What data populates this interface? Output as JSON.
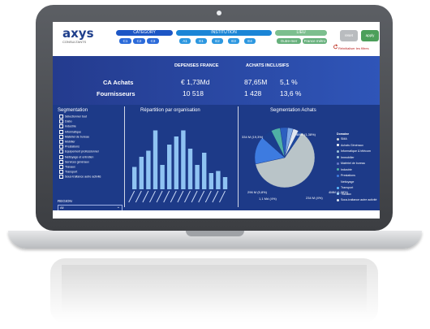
{
  "header": {
    "logo_text": "axys",
    "logo_sub": "CONSULTANTS",
    "filters": [
      {
        "title": "CATEGORY",
        "chips": [
          "C1",
          "C2",
          "C3"
        ]
      },
      {
        "title": "INSTITUTION",
        "chips": [
          "A1",
          "E1",
          "E2",
          "E3",
          "E4"
        ]
      },
      {
        "title": "LIEU",
        "chips": [
          "Outre-mer",
          "France métro"
        ]
      }
    ],
    "btn_reset": "reset",
    "btn_apply": "apply",
    "reset_text": "Réinitialiser les filtres"
  },
  "kpi": {
    "col_headers": [
      "DEPENSES FRANCE",
      "ACHATS INCLUSIFS"
    ],
    "rows": [
      {
        "label": "CA Achats",
        "value1": "€ 1,73Md",
        "value2": "87,65M",
        "pct": "5,1 %"
      },
      {
        "label": "Fournisseurs",
        "value1": "10 518",
        "value2": "1 428",
        "pct": "13,6 %"
      }
    ]
  },
  "segmentation": {
    "title": "Segmentation",
    "items": [
      "Sélectionner tout",
      "Dabo",
      "Industrie",
      "Informatique",
      "Matériel de bureau",
      "Mobilier",
      "Prestations",
      "Equipement professionnel",
      "Nettoyage et entretien",
      "Services généraux",
      "Travaux",
      "Transport",
      "Sous-traitance autre activité"
    ],
    "region_label": "REGION",
    "region_value": "All"
  },
  "bar_chart": {
    "title": "Répartition par organisation"
  },
  "pie_chart": {
    "title": "Segmentation Achats",
    "labels": [
      "334 M (19,3%)",
      "4MM (1,38%)",
      "296 M (5,8%)",
      "1,1 Md (4%)",
      "234 M (4%)",
      "4MM (1,38%)"
    ],
    "legend_title": "Domaine",
    "legend": [
      {
        "name": "SMA",
        "color": "#cfd6da"
      },
      {
        "name": "Achats Généraux",
        "color": "#ffffff"
      },
      {
        "name": "Informatique & télécom",
        "color": "#9fc5d8"
      },
      {
        "name": "Immobilier",
        "color": "#9fc5d8"
      },
      {
        "name": "Matériel de bureau",
        "color": "#6a7bc9"
      },
      {
        "name": "Industrie",
        "color": "#4fb0a5"
      },
      {
        "name": "Prestations",
        "color": "#3d7be0"
      },
      {
        "name": "Nettoyage",
        "color": "#1a3d8c"
      },
      {
        "name": "Transport",
        "color": "#5ab9ff"
      },
      {
        "name": "Travaux",
        "color": "#a5d8ff"
      },
      {
        "name": "Sous-traitance autre activité",
        "color": "#dfe7f1"
      }
    ]
  },
  "chart_data": [
    {
      "type": "bar",
      "title": "Répartition par organisation",
      "values": [
        55,
        80,
        95,
        145,
        60,
        110,
        130,
        145,
        100,
        60,
        90,
        40,
        45,
        30
      ]
    },
    {
      "type": "pie",
      "title": "Segmentation Achats",
      "values": [
        62,
        15,
        6,
        5,
        4,
        3,
        3,
        2
      ]
    }
  ]
}
